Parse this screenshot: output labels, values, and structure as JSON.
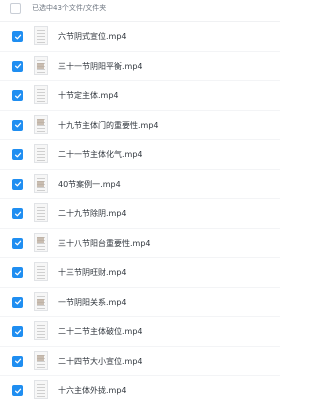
{
  "header": {
    "status": "已选中43个文件/文件夹"
  },
  "files": [
    {
      "name": "六节阴式宣位.mp4"
    },
    {
      "name": "三十一节阴阳平衡.mp4"
    },
    {
      "name": "十节定主体.mp4"
    },
    {
      "name": "十九节主体门的重要性.mp4"
    },
    {
      "name": "二十一节主体化气.mp4"
    },
    {
      "name": "40节案例一.mp4"
    },
    {
      "name": "二十九节除阴.mp4"
    },
    {
      "name": "三十八节阳台重要性.mp4"
    },
    {
      "name": "十三节阴旺财.mp4"
    },
    {
      "name": "一节阴阳关系.mp4"
    },
    {
      "name": "二十二节主体破位.mp4"
    },
    {
      "name": "二十四节大小宣位.mp4"
    },
    {
      "name": "十六主体外拢.mp4"
    }
  ],
  "colors": {
    "checkbox_checked": "#1f8ef1",
    "text": "#30363d",
    "header_text": "#6e7681"
  },
  "icons": {
    "checkbox": "checkmark-icon",
    "thumbnail": "video-thumbnail-icon"
  }
}
